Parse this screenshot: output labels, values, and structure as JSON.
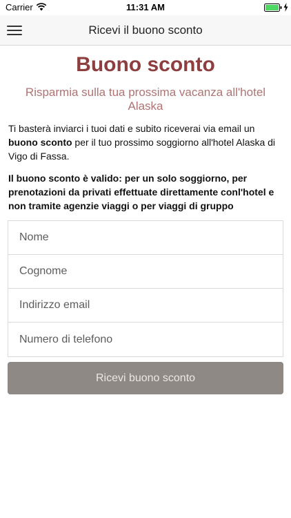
{
  "status_bar": {
    "carrier": "Carrier",
    "time": "11:31 AM",
    "battery_color": "#4cd964"
  },
  "nav": {
    "title": "Ricevi il buono sconto",
    "menu_icon": "hamburger-menu-icon"
  },
  "content": {
    "title": "Buono sconto",
    "subtitle": "Risparmia sulla tua prossima vacanza all'hotel Alaska",
    "intro_before": "Ti basterà inviarci i tuoi dati e subito riceverai via email un ",
    "intro_bold": "buono sconto",
    "intro_after": " per il tuo prossimo soggiorno all'hotel Alaska di Vigo di Fassa.",
    "notice": "Il buono sconto è valido: per un solo soggiorno, per prenotazioni da privati effettuate direttamente conl'hotel e non tramite agenzie viaggi o per viaggi di gruppo"
  },
  "form": {
    "nome_placeholder": "Nome",
    "cognome_placeholder": "Cognome",
    "email_placeholder": "Indirizzo email",
    "telefono_placeholder": "Numero di telefono",
    "submit_label": "Ricevi buono sconto"
  },
  "colors": {
    "title": "#8e3e3e",
    "subtitle": "#b07272",
    "button": "#8f8985"
  }
}
